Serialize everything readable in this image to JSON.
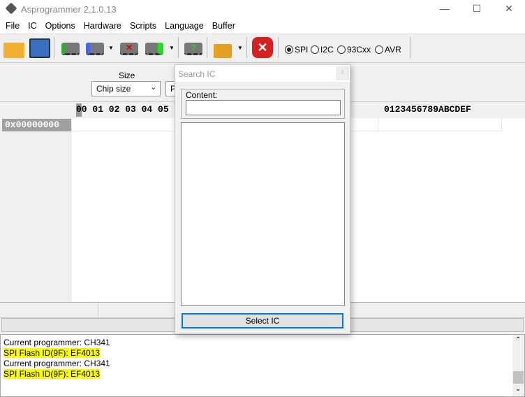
{
  "window": {
    "title": "Asprogrammer 2.1.0.13",
    "minimize": "—",
    "maximize": "☐",
    "close": "✕"
  },
  "menu": [
    "File",
    "IC",
    "Options",
    "Hardware",
    "Scripts",
    "Language",
    "Buffer"
  ],
  "toolbar": {
    "interfaces": [
      {
        "label": "SPI",
        "checked": true
      },
      {
        "label": "I2C",
        "checked": false
      },
      {
        "label": "93Cxx",
        "checked": false
      },
      {
        "label": "AVR",
        "checked": false
      }
    ]
  },
  "settings": {
    "size_label": "Size",
    "size_value": "Chip size",
    "second_combo_value": "P"
  },
  "hex": {
    "header": "00 01 02 03 04 05 06 07 08 09 0A 0B 0C 0D 0E 0F",
    "ascii_header": "0123456789ABCDEF",
    "address": "0x00000000"
  },
  "log": [
    {
      "text": "Current programmer: CH341",
      "highlight": false
    },
    {
      "text": "SPI Flash ID(9F): EF4013",
      "highlight": true
    },
    {
      "text": "Current programmer: CH341",
      "highlight": false
    },
    {
      "text": "SPI Flash ID(9F): EF4013",
      "highlight": true
    }
  ],
  "dialog": {
    "title": "Search IC",
    "close": "x",
    "content_label": "Content:",
    "content_value": "",
    "select_button": "Select IC"
  },
  "colors": {
    "highlight": "#ffff00",
    "focus": "#0078d7"
  }
}
